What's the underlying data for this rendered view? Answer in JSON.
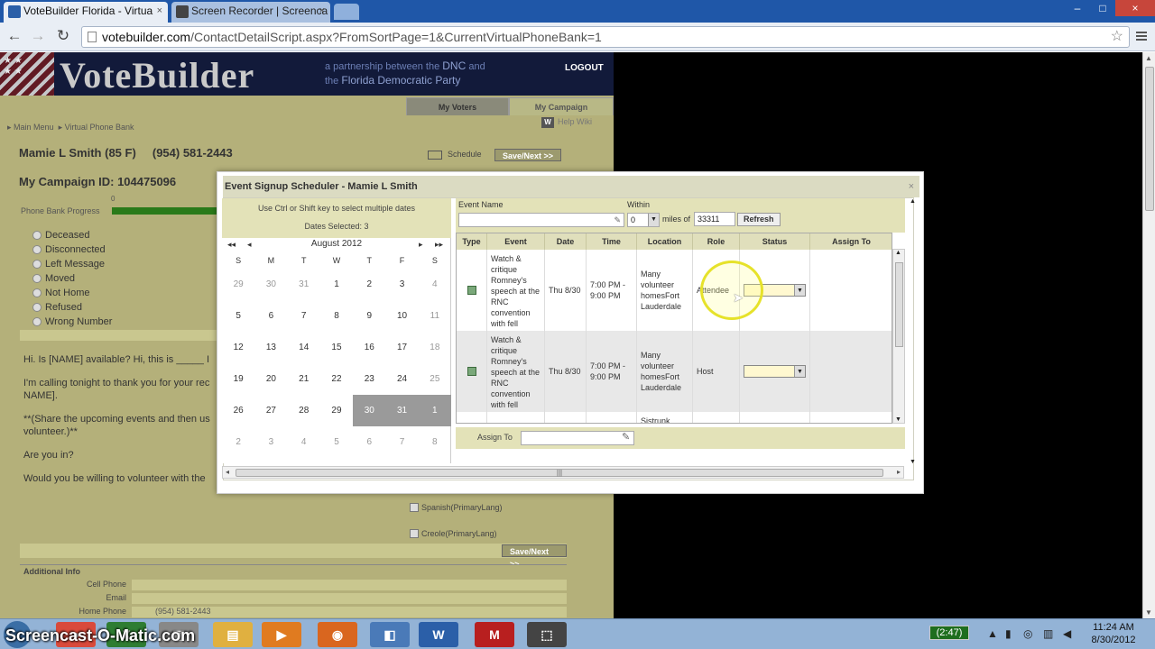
{
  "browser": {
    "tabs": [
      {
        "label": "VoteBuilder Florida - Virtua",
        "close": "×",
        "favicon_color": "#2b5fa8"
      },
      {
        "label": "Screen Recorder | Screenca",
        "close": "×",
        "favicon_color": "#444444"
      }
    ],
    "url_host": "votebuilder.com",
    "url_path": "/ContactDetailScript.aspx?FromSortPage=1&CurrentVirtualPhoneBank=1",
    "back_icon": "←",
    "forward_icon": "→",
    "reload_icon": "↻",
    "star_icon": "☆",
    "min_icon": "–",
    "max_icon": "□",
    "close_icon": "×"
  },
  "site": {
    "logo": "VoteBuilder",
    "tagline_pre": "a partnership between the",
    "tagline_dnc": "DNC",
    "tagline_and": "and",
    "tagline_the": "the",
    "tagline_party": "Florida Democratic Party",
    "logout": "LOGOUT",
    "tab_voters": "My Voters",
    "tab_campaign": "My Campaign",
    "breadcrumb_1": "Main Menu",
    "breadcrumb_2": "Virtual Phone Bank",
    "help_wiki": "Help Wiki"
  },
  "contact": {
    "name": "Mamie L Smith (85 F)",
    "phone": "(954) 581-2443",
    "campaign_id": "My Campaign ID: 104475096",
    "schedule": "Schedule",
    "save_next": "Save/Next >>",
    "progress_label": "Phone Bank Progress",
    "progress_count": "0",
    "progress": 1.0
  },
  "dispositions": [
    "Deceased",
    "Disconnected",
    "Left Message",
    "Moved",
    "Not Home",
    "Refused",
    "Wrong Number"
  ],
  "script": {
    "p1": "Hi. Is [NAME] available? Hi, this is _____ I",
    "p2": "I'm calling tonight to thank you for your rec",
    "p2b": "NAME].",
    "p3": "**(Share the upcoming events and then us",
    "p3b": "volunteer.)**",
    "p4": "Are you in?",
    "p5": "Would you be willing to volunteer with the"
  },
  "languages": [
    "Spanish(PrimaryLang)",
    "Creole(PrimaryLang)"
  ],
  "additional": {
    "header": "Additional Info",
    "cell_phone_label": "Cell Phone",
    "email_label": "Email",
    "home_phone_label": "Home Phone",
    "home_phone_value": "(954) 581-2443"
  },
  "dialog": {
    "title": "Event Signup Scheduler - Mamie L Smith",
    "close": "×",
    "hint": "Use Ctrl or Shift key to select multiple dates",
    "dates_selected": "Dates Selected: 3",
    "month": "August 2012",
    "nav_first": "◂◂",
    "nav_prev": "◂",
    "nav_next": "▸",
    "nav_last": "▸▸",
    "dow": [
      "S",
      "M",
      "T",
      "W",
      "T",
      "F",
      "S"
    ],
    "weeks": [
      [
        {
          "d": "29",
          "o": true
        },
        {
          "d": "30",
          "o": true
        },
        {
          "d": "31",
          "o": true
        },
        {
          "d": "1"
        },
        {
          "d": "2"
        },
        {
          "d": "3"
        },
        {
          "d": "4",
          "o": true
        }
      ],
      [
        {
          "d": "5"
        },
        {
          "d": "6"
        },
        {
          "d": "7"
        },
        {
          "d": "8"
        },
        {
          "d": "9"
        },
        {
          "d": "10"
        },
        {
          "d": "11",
          "o": true
        }
      ],
      [
        {
          "d": "12"
        },
        {
          "d": "13"
        },
        {
          "d": "14"
        },
        {
          "d": "15"
        },
        {
          "d": "16"
        },
        {
          "d": "17"
        },
        {
          "d": "18",
          "o": true
        }
      ],
      [
        {
          "d": "19"
        },
        {
          "d": "20"
        },
        {
          "d": "21"
        },
        {
          "d": "22"
        },
        {
          "d": "23"
        },
        {
          "d": "24"
        },
        {
          "d": "25",
          "o": true
        }
      ],
      [
        {
          "d": "26"
        },
        {
          "d": "27"
        },
        {
          "d": "28"
        },
        {
          "d": "29"
        },
        {
          "d": "30",
          "s": true
        },
        {
          "d": "31",
          "s": true
        },
        {
          "d": "1",
          "s": true
        }
      ],
      [
        {
          "d": "2",
          "o": true
        },
        {
          "d": "3",
          "o": true
        },
        {
          "d": "4",
          "o": true
        },
        {
          "d": "5",
          "o": true
        },
        {
          "d": "6",
          "o": true
        },
        {
          "d": "7",
          "o": true
        },
        {
          "d": "8",
          "o": true
        }
      ]
    ],
    "event_name_label": "Event Name",
    "event_name_value": "",
    "within_label": "Within",
    "within_value": "0",
    "miles_of": "miles of",
    "zip": "33311",
    "refresh": "Refresh",
    "columns": [
      "Type",
      "Event",
      "Date",
      "Time",
      "Location",
      "Role",
      "Status",
      "Assign To"
    ],
    "rows": [
      {
        "event": "Watch & critique Romney's speech at the RNC convention with fell",
        "date": "Thu 8/30",
        "time": "7:00 PM - 9:00 PM",
        "location": "Many volunteer homesFort Lauderdale",
        "role": "Attendee",
        "status": ""
      },
      {
        "event": "Watch & critique Romney's speech at the RNC convention with fell",
        "date": "Thu 8/30",
        "time": "7:00 PM - 9:00 PM",
        "location": "Many volunteer homesFort Lauderdale",
        "role": "Host",
        "status": ""
      },
      {
        "event": "",
        "date": "",
        "time": "",
        "location": "Sistrunk",
        "role": "",
        "status": ""
      }
    ],
    "assign_to_label": "Assign To",
    "assign_to_value": "",
    "scroll_grip": "|||"
  },
  "taskbar": {
    "watermark": "Screencast-O-Matic.com",
    "tray_badge": "(2:47)",
    "time": "11:24 AM",
    "date": "8/30/2012",
    "apps": [
      {
        "name": "chrome-icon",
        "color": "#d94a3b",
        "glyph": "●"
      },
      {
        "name": "excel-icon",
        "color": "#2e7d32",
        "glyph": "X"
      },
      {
        "name": "app3-icon",
        "color": "#888888",
        "glyph": "▣"
      },
      {
        "name": "explorer-icon",
        "color": "#e0b040",
        "glyph": "▤"
      },
      {
        "name": "media-icon",
        "color": "#e07b20",
        "glyph": "▶"
      },
      {
        "name": "firefox-icon",
        "color": "#d9661f",
        "glyph": "◉"
      },
      {
        "name": "network-icon",
        "color": "#4a7ab8",
        "glyph": "◧"
      },
      {
        "name": "word-icon",
        "color": "#2b5fa8",
        "glyph": "W"
      },
      {
        "name": "mcafee-icon",
        "color": "#b81f1f",
        "glyph": "M"
      },
      {
        "name": "snip-icon",
        "color": "#444444",
        "glyph": "⬚"
      }
    ]
  },
  "colors": {
    "accent": "#1f57a8",
    "olive": "#b4b07a",
    "header_navy": "#121a3a",
    "progress": "#2a7a1a"
  }
}
